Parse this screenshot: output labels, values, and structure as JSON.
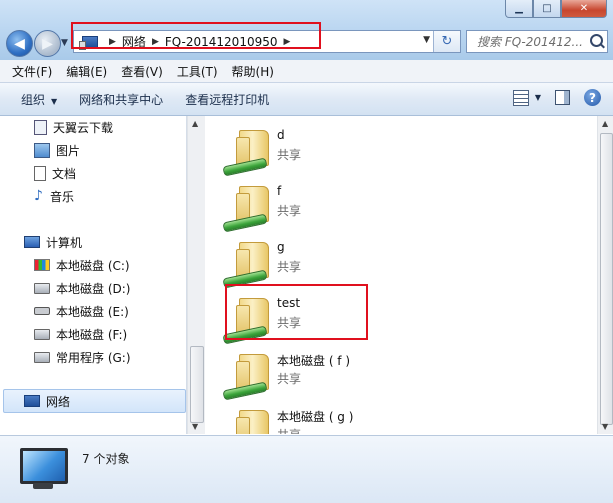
{
  "window": {
    "minimize": "▁",
    "maximize": "□",
    "close": "✕"
  },
  "address": {
    "segments": [
      "网络",
      "FQ-201412010950"
    ]
  },
  "search": {
    "placeholder": "搜索 FQ-201412..."
  },
  "menu": [
    "文件(F)",
    "编辑(E)",
    "查看(V)",
    "工具(T)",
    "帮助(H)"
  ],
  "toolbar": {
    "organize": "组织",
    "network_center": "网络和共享中心",
    "remote_printers": "查看远程打印机"
  },
  "nav": {
    "favorites": [
      "天翼云下载",
      "图片",
      "文档",
      "音乐"
    ],
    "computer": "计算机",
    "drives": [
      "本地磁盘 (C:)",
      "本地磁盘 (D:)",
      "本地磁盘 (E:)",
      "本地磁盘 (F:)",
      "常用程序 (G:)"
    ],
    "network": "网络"
  },
  "files": [
    {
      "name": "d",
      "status": "共享"
    },
    {
      "name": "f",
      "status": "共享"
    },
    {
      "name": "g",
      "status": "共享"
    },
    {
      "name": "test",
      "status": "共享"
    },
    {
      "name": "本地磁盘 ( f )",
      "status": "共享"
    },
    {
      "name": "本地磁盘 ( g )",
      "status": "共享"
    }
  ],
  "details": {
    "count": "7 个对象"
  },
  "highlight_color": "#e0101e"
}
